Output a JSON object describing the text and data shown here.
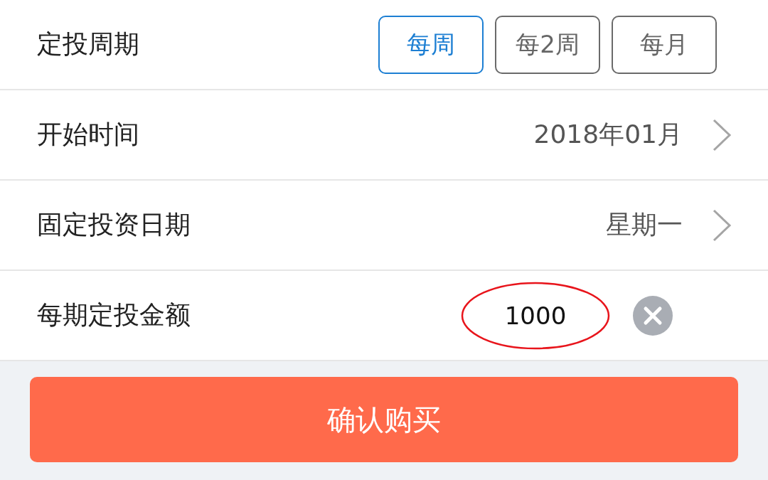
{
  "rows": [
    {
      "kind": "options",
      "label": "定投周期",
      "options": [
        {
          "label": "每周",
          "selected": true
        },
        {
          "label": "每2周",
          "selected": false
        },
        {
          "label": "每月",
          "selected": false
        }
      ]
    },
    {
      "kind": "link",
      "label": "开始时间",
      "value": "2018年01月"
    },
    {
      "kind": "link",
      "label": "固定投资日期",
      "value": "星期一"
    },
    {
      "kind": "input",
      "label": "每期定投金额",
      "value": "1000",
      "circled": true
    }
  ],
  "confirm_button": "确认购买"
}
